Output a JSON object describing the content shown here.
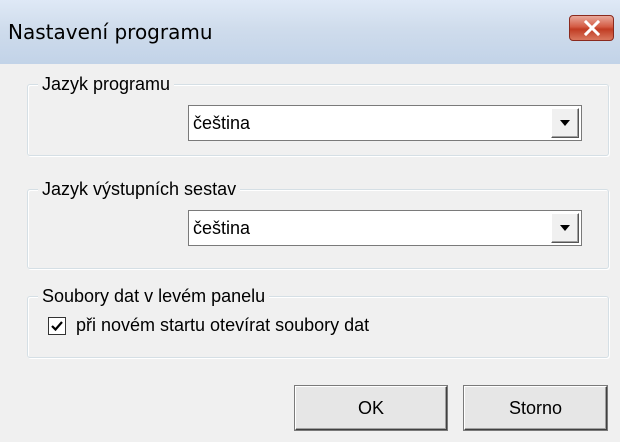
{
  "window": {
    "title": "Nastavení programu"
  },
  "program_language": {
    "label": "Jazyk programu",
    "selected": "čeština"
  },
  "report_language": {
    "label": "Jazyk výstupních sestav",
    "selected": "čeština"
  },
  "data_files": {
    "label": "Soubory dat v levém panelu",
    "checkbox_label": "při novém startu otevírat soubory dat",
    "checked": true
  },
  "buttons": {
    "ok": "OK",
    "cancel": "Storno"
  }
}
